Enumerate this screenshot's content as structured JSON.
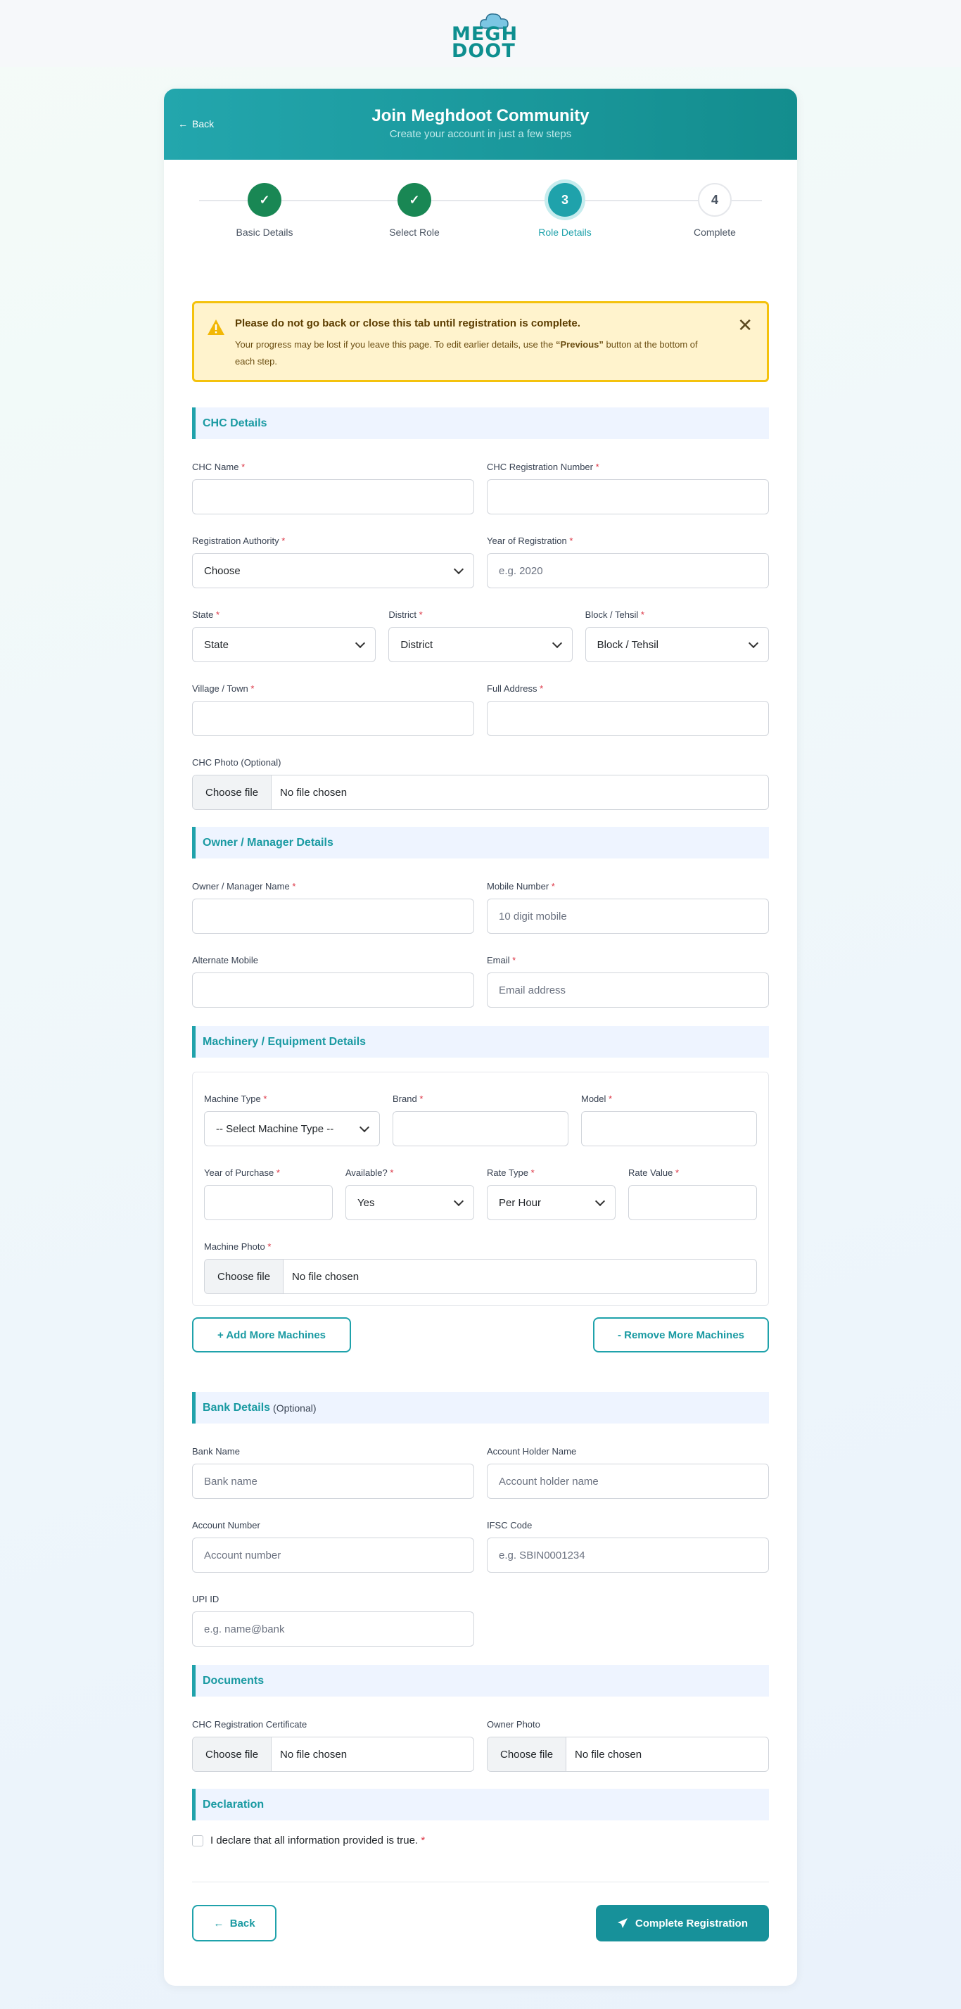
{
  "logo": {
    "line1": "MEGH",
    "line2": "DOOT"
  },
  "header": {
    "back_label": "Back",
    "title": "Join Meghdoot Community",
    "subtitle": "Create your account in just a few steps"
  },
  "steps": [
    {
      "label": "Basic Details",
      "state": "done"
    },
    {
      "label": "Select Role",
      "state": "done"
    },
    {
      "label": "Role Details",
      "state": "active",
      "number": "3"
    },
    {
      "label": "Complete",
      "state": "todo",
      "number": "4"
    }
  ],
  "alert": {
    "title": "Please do not go back or close this tab until registration is complete.",
    "text_before": "Your progress may be lost if you leave this page. To edit earlier details, use the ",
    "text_bold": "“Previous”",
    "text_after": " button at the bottom of each step."
  },
  "sections": {
    "chc": "CHC Details",
    "owner": "Owner / Manager Details",
    "machinery": "Machinery / Equipment Details",
    "bank": "Bank Details",
    "bank_optional": "(Optional)",
    "documents": "Documents",
    "declaration": "Declaration"
  },
  "chc": {
    "name_label": "CHC Name",
    "reg_number_label": "CHC Registration Number",
    "authority_label": "Registration Authority",
    "authority_value": "Choose",
    "year_label": "Year of Registration",
    "year_placeholder": "e.g. 2020",
    "state_label": "State",
    "state_value": "State",
    "district_label": "District",
    "district_value": "District",
    "block_label": "Block / Tehsil",
    "block_value": "Block / Tehsil",
    "village_label": "Village / Town",
    "address_label": "Full Address",
    "photo_label": "CHC Photo (Optional)"
  },
  "file": {
    "button": "Choose file",
    "status": "No file chosen"
  },
  "owner": {
    "name_label": "Owner / Manager Name",
    "mobile_label": "Mobile Number",
    "mobile_placeholder": "10 digit mobile",
    "alt_mobile_label": "Alternate Mobile",
    "email_label": "Email",
    "email_placeholder": "Email address"
  },
  "machine": {
    "type_label": "Machine Type",
    "type_value": "-- Select Machine Type --",
    "brand_label": "Brand",
    "model_label": "Model",
    "purchase_label": "Year of Purchase",
    "available_label": "Available?",
    "available_value": "Yes",
    "rate_type_label": "Rate Type",
    "rate_type_value": "Per Hour",
    "rate_value_label": "Rate Value",
    "photo_label": "Machine Photo",
    "add_label": "+ Add More Machines",
    "remove_label": "- Remove More Machines"
  },
  "bank": {
    "name_label": "Bank Name",
    "name_placeholder": "Bank name",
    "holder_label": "Account Holder Name",
    "holder_placeholder": "Account holder name",
    "account_label": "Account Number",
    "account_placeholder": "Account number",
    "ifsc_label": "IFSC Code",
    "ifsc_placeholder": "e.g. SBIN0001234",
    "upi_label": "UPI ID",
    "upi_placeholder": "e.g. name@bank"
  },
  "documents": {
    "cert_label": "CHC Registration Certificate",
    "owner_photo_label": "Owner Photo"
  },
  "declaration": {
    "text": "I declare that all information provided is true."
  },
  "footer": {
    "back_label": "Back",
    "submit_label": "Complete Registration"
  },
  "colors": {
    "accent": "#1fa2ab",
    "done": "#198754",
    "warning_border": "#f4c20d",
    "warning_bg": "#fff3cd"
  }
}
